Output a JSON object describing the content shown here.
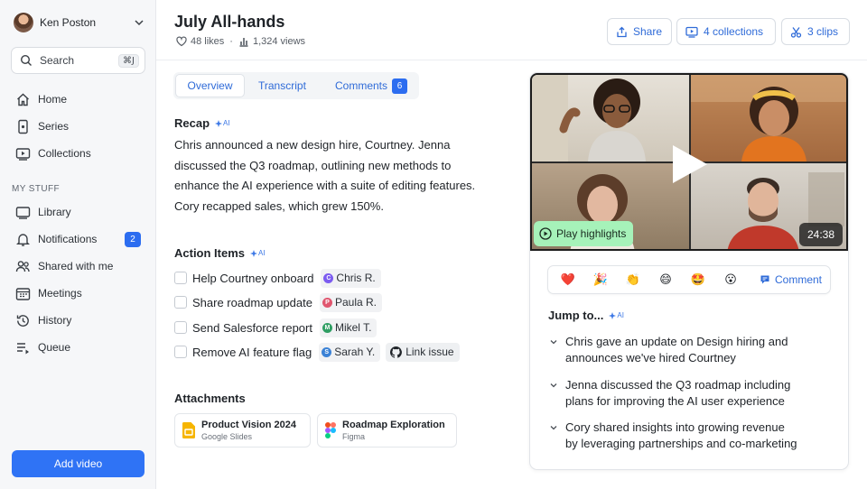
{
  "user": {
    "name": "Ken Poston"
  },
  "search": {
    "placeholder": "Search",
    "shortcut": "⌘J"
  },
  "nav": {
    "main": [
      {
        "label": "Home",
        "icon": "home-icon"
      },
      {
        "label": "Series",
        "icon": "series-icon"
      },
      {
        "label": "Collections",
        "icon": "collections-icon"
      }
    ],
    "section_label": "MY STUFF",
    "stuff": [
      {
        "label": "Library",
        "icon": "library-icon"
      },
      {
        "label": "Notifications",
        "icon": "bell-icon",
        "badge": "2"
      },
      {
        "label": "Shared with me",
        "icon": "people-icon"
      },
      {
        "label": "Meetings",
        "icon": "calendar-icon"
      },
      {
        "label": "History",
        "icon": "history-icon"
      },
      {
        "label": "Queue",
        "icon": "queue-icon"
      }
    ]
  },
  "add_video": "Add video",
  "header": {
    "title": "July All-hands",
    "likes": "48 likes",
    "views": "1,324 views",
    "share": "Share",
    "collections": "4 collections",
    "clips": "3 clips"
  },
  "tabs": {
    "overview": "Overview",
    "transcript": "Transcript",
    "comments": "Comments",
    "comments_count": "6"
  },
  "recap": {
    "title": "Recap",
    "ai": "AI",
    "text": "Chris announced a new design hire, Courtney. Jenna discussed the Q3 roadmap, outlining new methods to enhance the AI experience with a suite of editing features. Cory recapped sales, which grew 150%."
  },
  "action_items": {
    "title": "Action Items",
    "ai": "AI",
    "items": [
      {
        "text": "Help Courtney onboard",
        "assignee": "Chris R.",
        "initial": "C",
        "color": "#7c5cf0"
      },
      {
        "text": "Share roadmap update",
        "assignee": "Paula R.",
        "initial": "P",
        "color": "#e0566f"
      },
      {
        "text": "Send Salesforce report",
        "assignee": "Mikel T.",
        "initial": "M",
        "color": "#2f9e63"
      },
      {
        "text": "Remove AI feature flag",
        "assignee": "Sarah Y.",
        "initial": "S",
        "color": "#3b82d6"
      }
    ],
    "link_issue": "Link issue"
  },
  "attachments": {
    "title": "Attachments",
    "items": [
      {
        "title": "Product Vision 2024",
        "subtitle": "Google Slides",
        "icon": "google-slides-icon"
      },
      {
        "title": "Roadmap Exploration",
        "subtitle": "Figma",
        "icon": "figma-icon"
      }
    ]
  },
  "video": {
    "highlights": "Play highlights",
    "duration": "24:38"
  },
  "reactions": {
    "emojis": [
      "❤️",
      "🎉",
      "👏",
      "😄",
      "🤩",
      "😮"
    ],
    "comment": "Comment"
  },
  "jump": {
    "title": "Jump to...",
    "ai": "AI",
    "items": [
      {
        "line1": "Chris gave an update on Design hiring and",
        "line2": "announces we've hired Courtney"
      },
      {
        "line1": "Jenna discussed the Q3 roadmap including",
        "line2": "plans for improving the AI user experience"
      },
      {
        "line1": "Cory shared insights into growing revenue",
        "line2": "by leveraging partnerships and co-marketing"
      }
    ]
  },
  "colors": {
    "accent": "#2f73f5",
    "link": "#2f6bd8",
    "highlight": "#a6f2b9"
  }
}
